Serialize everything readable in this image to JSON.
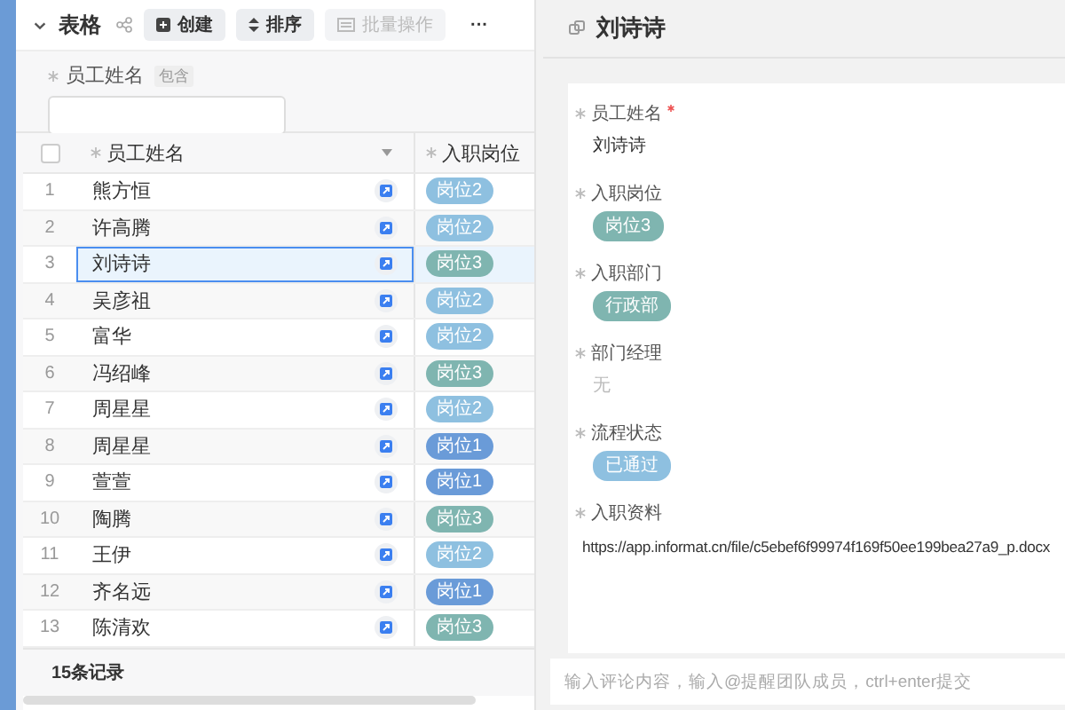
{
  "toolbar": {
    "title": "表格",
    "buttons": [
      {
        "label": "创建",
        "disabled": false
      },
      {
        "label": "排序",
        "disabled": false
      },
      {
        "label": "批量操作",
        "disabled": true
      }
    ],
    "more": "···"
  },
  "filter": {
    "label": "员工姓名",
    "operator": "包含"
  },
  "table": {
    "columns": [
      "员工姓名",
      "入职岗位"
    ],
    "select_all_checked": false,
    "rows": [
      {
        "index": "1",
        "name": "熊方恒",
        "position": "岗位2",
        "color": "#8ec0e0",
        "selected": false
      },
      {
        "index": "2",
        "name": "许高腾",
        "position": "岗位2",
        "color": "#8ec0e0",
        "selected": false
      },
      {
        "index": "3",
        "name": "刘诗诗",
        "position": "岗位3",
        "color": "#7fb5b0",
        "selected": true
      },
      {
        "index": "4",
        "name": "吴彦祖",
        "position": "岗位2",
        "color": "#8ec0e0",
        "selected": false
      },
      {
        "index": "5",
        "name": "富华",
        "position": "岗位2",
        "color": "#8ec0e0",
        "selected": false
      },
      {
        "index": "6",
        "name": "冯绍峰",
        "position": "岗位3",
        "color": "#7fb5b0",
        "selected": false
      },
      {
        "index": "7",
        "name": "周星星",
        "position": "岗位2",
        "color": "#8ec0e0",
        "selected": false
      },
      {
        "index": "8",
        "name": "周星星",
        "position": "岗位1",
        "color": "#6a9bd8",
        "selected": false
      },
      {
        "index": "9",
        "name": "萱萱",
        "position": "岗位1",
        "color": "#6a9bd8",
        "selected": false
      },
      {
        "index": "10",
        "name": "陶腾",
        "position": "岗位3",
        "color": "#7fb5b0",
        "selected": false
      },
      {
        "index": "11",
        "name": "王伊",
        "position": "岗位2",
        "color": "#8ec0e0",
        "selected": false
      },
      {
        "index": "12",
        "name": "齐名远",
        "position": "岗位1",
        "color": "#6a9bd8",
        "selected": false
      },
      {
        "index": "13",
        "name": "陈清欢",
        "position": "岗位3",
        "color": "#7fb5b0",
        "selected": false
      }
    ],
    "footer": "15条记录"
  },
  "detail": {
    "title": "刘诗诗",
    "fields": [
      {
        "label": "员工姓名",
        "required": true,
        "kind": "text",
        "value": "刘诗诗"
      },
      {
        "label": "入职岗位",
        "required": false,
        "kind": "tag",
        "value": "岗位3",
        "color": "#7fb5b0"
      },
      {
        "label": "入职部门",
        "required": false,
        "kind": "tag",
        "value": "行政部",
        "color": "#7fb5b0"
      },
      {
        "label": "部门经理",
        "required": false,
        "kind": "empty",
        "value": "无"
      },
      {
        "label": "流程状态",
        "required": false,
        "kind": "tag",
        "value": "已通过",
        "color": "#8ec0e0"
      },
      {
        "label": "入职资料",
        "required": false,
        "kind": "text",
        "value": "https://app.informat.cn/file/c5ebef6f99974f169f50ee199bea27a9_p.docx"
      }
    ]
  },
  "comment": {
    "placeholder": "输入评论内容，输入@提醒团队成员，ctrl+enter提交"
  }
}
